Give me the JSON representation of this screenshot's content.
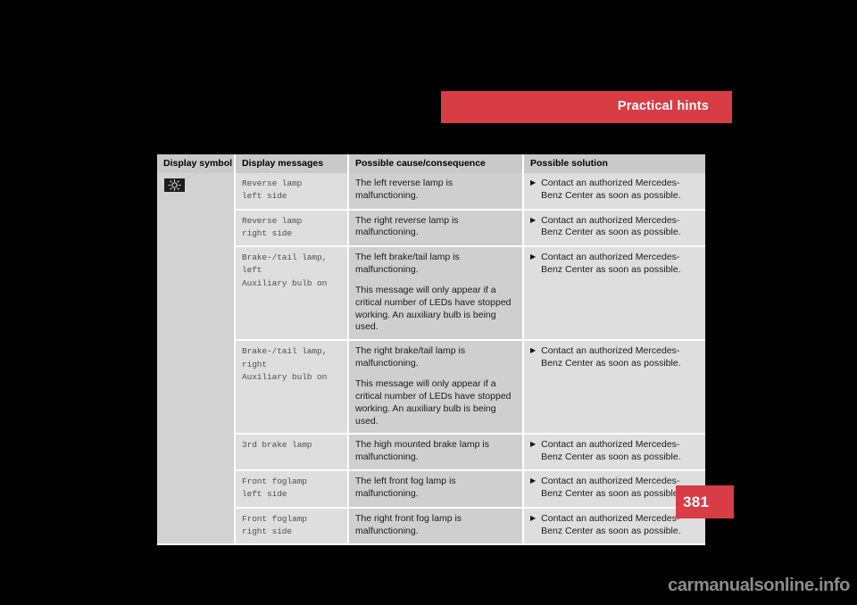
{
  "header": {
    "title": "Practical hints",
    "banner_color": "#d83c45"
  },
  "table": {
    "columns": [
      "Display symbol",
      "Display messages",
      "Possible cause/consequence",
      "Possible solution"
    ],
    "symbol": {
      "icon": "lamp-bulb-indicator-icon"
    },
    "rows": [
      {
        "message": "Reverse lamp\nleft side",
        "cause": [
          "The left reverse lamp is malfunctioning."
        ],
        "solution": [
          "Contact an authorized Mercedes-Benz Center as soon as possible."
        ]
      },
      {
        "message": "Reverse lamp\nright side",
        "cause": [
          "The right reverse lamp is malfunctioning."
        ],
        "solution": [
          "Contact an authorized Mercedes-Benz Center as soon as possible."
        ]
      },
      {
        "message": "Brake-/tail lamp, left\nAuxiliary bulb on",
        "cause": [
          "The left brake/tail lamp is malfunctioning.",
          "This message will only appear if a critical number of LEDs have stopped working. An auxiliary bulb is being used."
        ],
        "solution": [
          "Contact an authorized Mercedes-Benz Center as soon as possible."
        ]
      },
      {
        "message": "Brake-/tail lamp, right\nAuxiliary bulb on",
        "cause": [
          "The right brake/tail lamp is malfunctioning.",
          "This message will only appear if a critical number of LEDs have stopped working. An auxiliary bulb is being used."
        ],
        "solution": [
          "Contact an authorized Mercedes-Benz Center as soon as possible."
        ]
      },
      {
        "message": "3rd brake lamp",
        "cause": [
          "The high mounted brake lamp is malfunctioning."
        ],
        "solution": [
          "Contact an authorized Mercedes-Benz Center as soon as possible."
        ]
      },
      {
        "message": "Front foglamp\nleft side",
        "cause": [
          "The left front fog lamp is malfunctioning."
        ],
        "solution": [
          "Contact an authorized Mercedes-Benz Center as soon as possible."
        ]
      },
      {
        "message": "Front foglamp\nright side",
        "cause": [
          "The right front fog lamp is malfunctioning."
        ],
        "solution": [
          "Contact an authorized Mercedes-Benz Center as soon as possible."
        ]
      }
    ],
    "bullet_glyph": "▶"
  },
  "page": {
    "number": "381"
  },
  "watermark": {
    "text": "carmanualsonline.info"
  }
}
